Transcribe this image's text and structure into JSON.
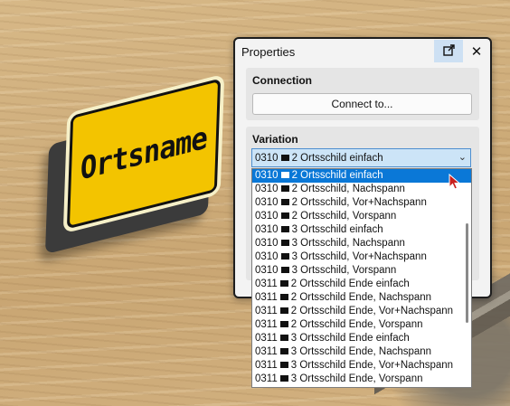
{
  "scene": {
    "sign_text": "Ortsname",
    "sign_color": "#f3c400"
  },
  "panel": {
    "title": "Properties",
    "popout_icon": "popout-icon",
    "close_icon": "close-icon",
    "connection": {
      "label": "Connection",
      "button_label": "Connect to..."
    },
    "variation": {
      "label": "Variation",
      "selected_code": "0310",
      "selected_name": "2 Ortsschild einfach",
      "options": [
        {
          "code": "0310",
          "name": "2 Ortsschild einfach",
          "selected": true
        },
        {
          "code": "0310",
          "name": "2 Ortsschild, Nachspann"
        },
        {
          "code": "0310",
          "name": "2 Ortsschild, Vor+Nachspann"
        },
        {
          "code": "0310",
          "name": "2 Ortsschild, Vorspann"
        },
        {
          "code": "0310",
          "name": "3 Ortsschild einfach"
        },
        {
          "code": "0310",
          "name": "3 Ortsschild, Nachspann"
        },
        {
          "code": "0310",
          "name": "3 Ortsschild, Vor+Nachspann"
        },
        {
          "code": "0310",
          "name": "3 Ortsschild, Vorspann"
        },
        {
          "code": "0311",
          "name": "2 Ortsschild Ende einfach"
        },
        {
          "code": "0311",
          "name": "2 Ortsschild Ende, Nachspann"
        },
        {
          "code": "0311",
          "name": "2 Ortsschild Ende, Vor+Nachspann"
        },
        {
          "code": "0311",
          "name": "2 Ortsschild Ende, Vorspann"
        },
        {
          "code": "0311",
          "name": "3 Ortsschild Ende einfach"
        },
        {
          "code": "0311",
          "name": "3 Ortsschild Ende, Nachspann"
        },
        {
          "code": "0311",
          "name": "3 Ortsschild Ende, Vor+Nachspann"
        },
        {
          "code": "0311",
          "name": "3 Ortsschild Ende, Vorspann"
        }
      ]
    }
  },
  "colors": {
    "accent": "#0a78d7",
    "combo_bg": "#cce4f7",
    "panel_bg": "#f3f3f3"
  }
}
